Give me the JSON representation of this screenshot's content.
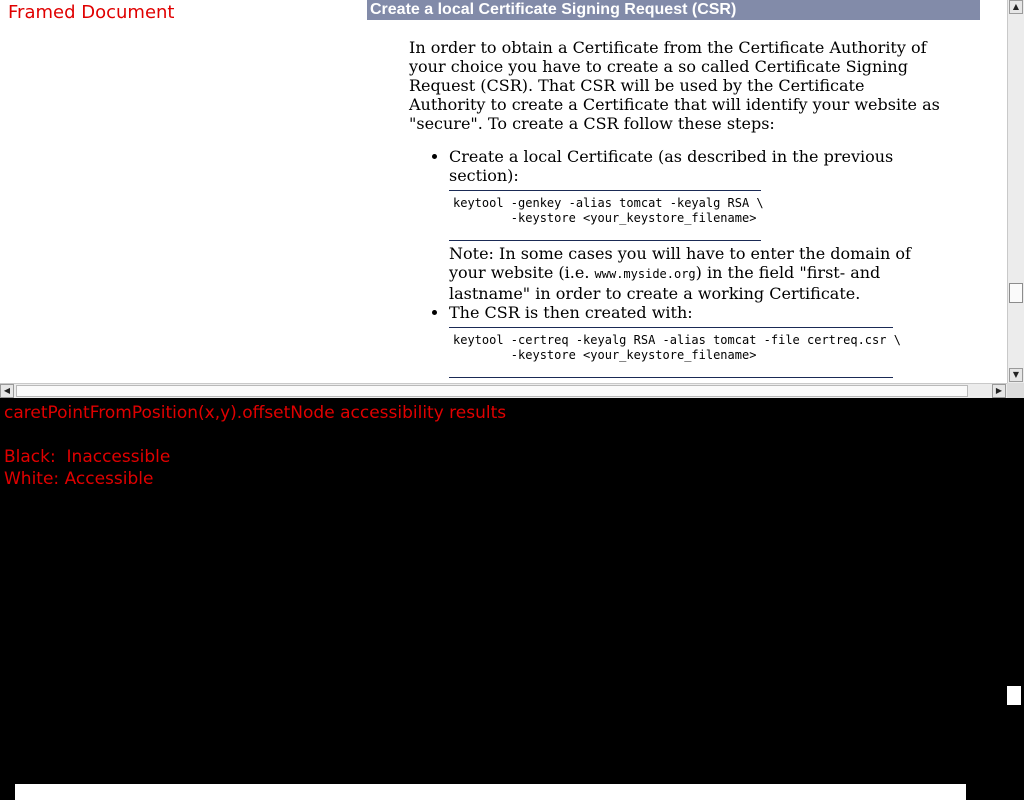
{
  "frame": {
    "label": "Framed Document",
    "section_title": "Create a local Certificate Signing Request (CSR)",
    "intro": "In order to obtain a Certificate from the Certificate Authority of your choice you have to create a so called Certificate Signing Request (CSR). That CSR will be used by the Certificate Authority to create a Certificate that will identify your website as \"secure\". To create a CSR follow these steps:",
    "steps": [
      {
        "text": "Create a local Certificate (as described in the previous section):",
        "code": "keytool -genkey -alias tomcat -keyalg RSA \\\n        -keystore <your_keystore_filename>",
        "note_before": "Note: In some cases you will have to enter the domain of your website (i.e. ",
        "note_code": "www.myside.org",
        "note_after": ") in the field \"first- and lastname\" in order to create a working Certificate."
      },
      {
        "text": "The CSR is then created with:",
        "code": "keytool -certreq -keyalg RSA -alias tomcat -file certreq.csr \\\n        -keystore <your_keystore_filename>"
      }
    ]
  },
  "scrollbars": {
    "up_arrow": "▲",
    "down_arrow": "▼",
    "left_arrow": "◀",
    "right_arrow": "▶"
  },
  "results": {
    "title": "caretPointFromPosition(x,y).offsetNode accessibility results",
    "black_label": "Black:  Inaccessible",
    "white_label": "White: Accessible"
  },
  "colors": {
    "header_bar": "#828ba9",
    "label_red": "#e00000",
    "background": "#000000"
  }
}
